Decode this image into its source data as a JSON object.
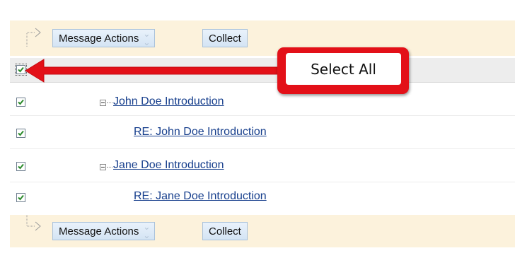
{
  "toolbar": {
    "message_actions_label": "Message Actions",
    "collect_label": "Collect"
  },
  "callout": {
    "text": "Select All",
    "color": "#e31018"
  },
  "threads": [
    {
      "title": "John Doe Introduction",
      "level": 0,
      "checked": true
    },
    {
      "title": "RE: John Doe Introduction",
      "level": 1,
      "checked": true
    },
    {
      "title": "Jane Doe Introduction",
      "level": 0,
      "checked": true
    },
    {
      "title": "RE: Jane Doe Introduction",
      "level": 1,
      "checked": true
    }
  ],
  "select_all_checked": true,
  "colors": {
    "toolbar_bg": "#fcf2dc",
    "link": "#163e8c",
    "check": "#2a8a2a"
  }
}
